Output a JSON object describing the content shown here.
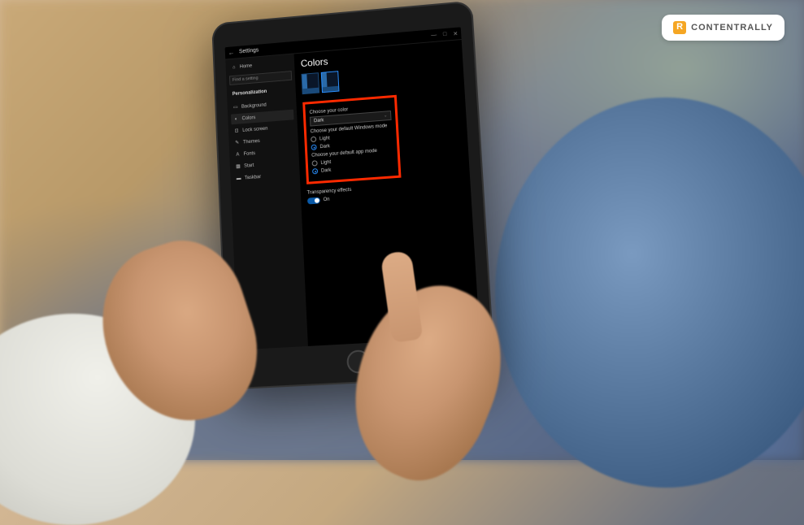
{
  "badge": {
    "text": "CONTENTRALLY"
  },
  "window": {
    "back_label": "←",
    "title": "Settings",
    "controls": {
      "min": "—",
      "max": "□",
      "close": "✕"
    }
  },
  "sidebar": {
    "home_label": "Home",
    "search_placeholder": "Find a setting",
    "section_heading": "Personalization",
    "items": [
      {
        "label": "Background",
        "icon": "▭"
      },
      {
        "label": "Colors",
        "icon": "◐"
      },
      {
        "label": "Lock screen",
        "icon": "⊡"
      },
      {
        "label": "Themes",
        "icon": "✎"
      },
      {
        "label": "Fonts",
        "icon": "A"
      },
      {
        "label": "Start",
        "icon": "▦"
      },
      {
        "label": "Taskbar",
        "icon": "▬"
      }
    ]
  },
  "content": {
    "title": "Colors",
    "choose_color_label": "Choose your color",
    "color_dropdown_value": "Dark",
    "windows_mode_label": "Choose your default Windows mode",
    "app_mode_label": "Choose your default app mode",
    "option_light": "Light",
    "option_dark": "Dark",
    "windows_mode_selected": "Dark",
    "app_mode_selected": "Dark",
    "transparency_label": "Transparency effects",
    "transparency_state": "On"
  }
}
